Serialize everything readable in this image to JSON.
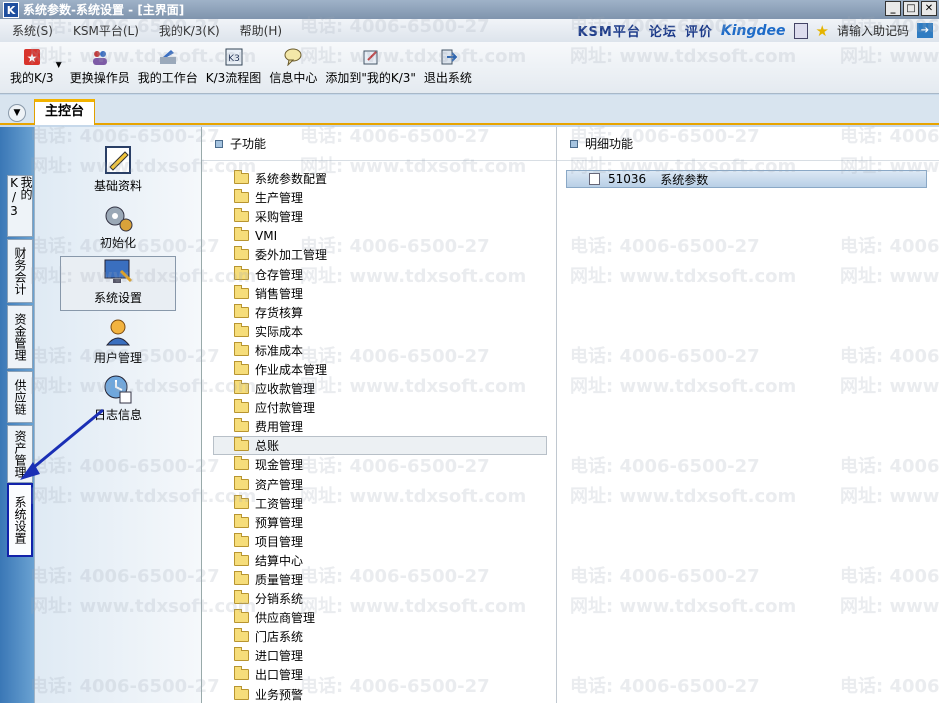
{
  "window": {
    "title": "系统参数-系统设置 - [主界面]",
    "app_icon_letter": "K"
  },
  "menubar": {
    "items": [
      "系统(S)",
      "KSM平台(L)",
      "我的K/3(K)",
      "帮助(H)"
    ],
    "right": {
      "ksm": "KSM平台",
      "forum": "论坛",
      "rate": "评价",
      "brand": "Kingdee",
      "helper": "请输入助记码"
    }
  },
  "toolbar": {
    "buttons": [
      {
        "label": "我的K/3",
        "icon": "star-icon"
      },
      {
        "label": "更换操作员",
        "icon": "users-icon"
      },
      {
        "label": "我的工作台",
        "icon": "desk-icon"
      },
      {
        "label": "K/3流程图",
        "icon": "flowchart-icon"
      },
      {
        "label": "信息中心",
        "icon": "message-icon"
      },
      {
        "label": "添加到\"我的K/3\"",
        "icon": "add-favorite-icon"
      },
      {
        "label": "退出系统",
        "icon": "exit-icon"
      }
    ]
  },
  "tabs": {
    "main": "主控台"
  },
  "vtabs": [
    {
      "label": "我的K/3"
    },
    {
      "label": "财务会计"
    },
    {
      "label": "资金管理"
    },
    {
      "label": "供应链"
    },
    {
      "label": "资产管理"
    },
    {
      "label": "系统设置",
      "selected": true
    }
  ],
  "panel": {
    "items": [
      {
        "label": "基础资料",
        "icon": "basic-data-icon"
      },
      {
        "label": "初始化",
        "icon": "gears-icon"
      },
      {
        "label": "系统设置",
        "icon": "monitor-settings-icon",
        "selected": true
      },
      {
        "label": "用户管理",
        "icon": "user-manage-icon"
      },
      {
        "label": "日志信息",
        "icon": "log-clock-icon"
      }
    ]
  },
  "subfunctions": {
    "header": "子功能",
    "items": [
      "系统参数配置",
      "生产管理",
      "采购管理",
      "VMI",
      "委外加工管理",
      "仓存管理",
      "销售管理",
      "存货核算",
      "实际成本",
      "标准成本",
      "作业成本管理",
      "应收款管理",
      "应付款管理",
      "费用管理",
      "总账",
      "现金管理",
      "资产管理",
      "工资管理",
      "预算管理",
      "项目管理",
      "结算中心",
      "质量管理",
      "分销系统",
      "供应商管理",
      "门店系统",
      "进口管理",
      "出口管理",
      "业务预警"
    ],
    "selected_index": 14
  },
  "details": {
    "header": "明细功能",
    "items": [
      {
        "code": "51036",
        "label": "系统参数"
      }
    ]
  },
  "watermark": {
    "phone": "电话: 4006-6500-27",
    "site": "网址: www.tdxsoft.com"
  },
  "colors": {
    "accent": "#e8a400",
    "selection_border": "#1122aa",
    "arrow": "#1a2fb5"
  }
}
